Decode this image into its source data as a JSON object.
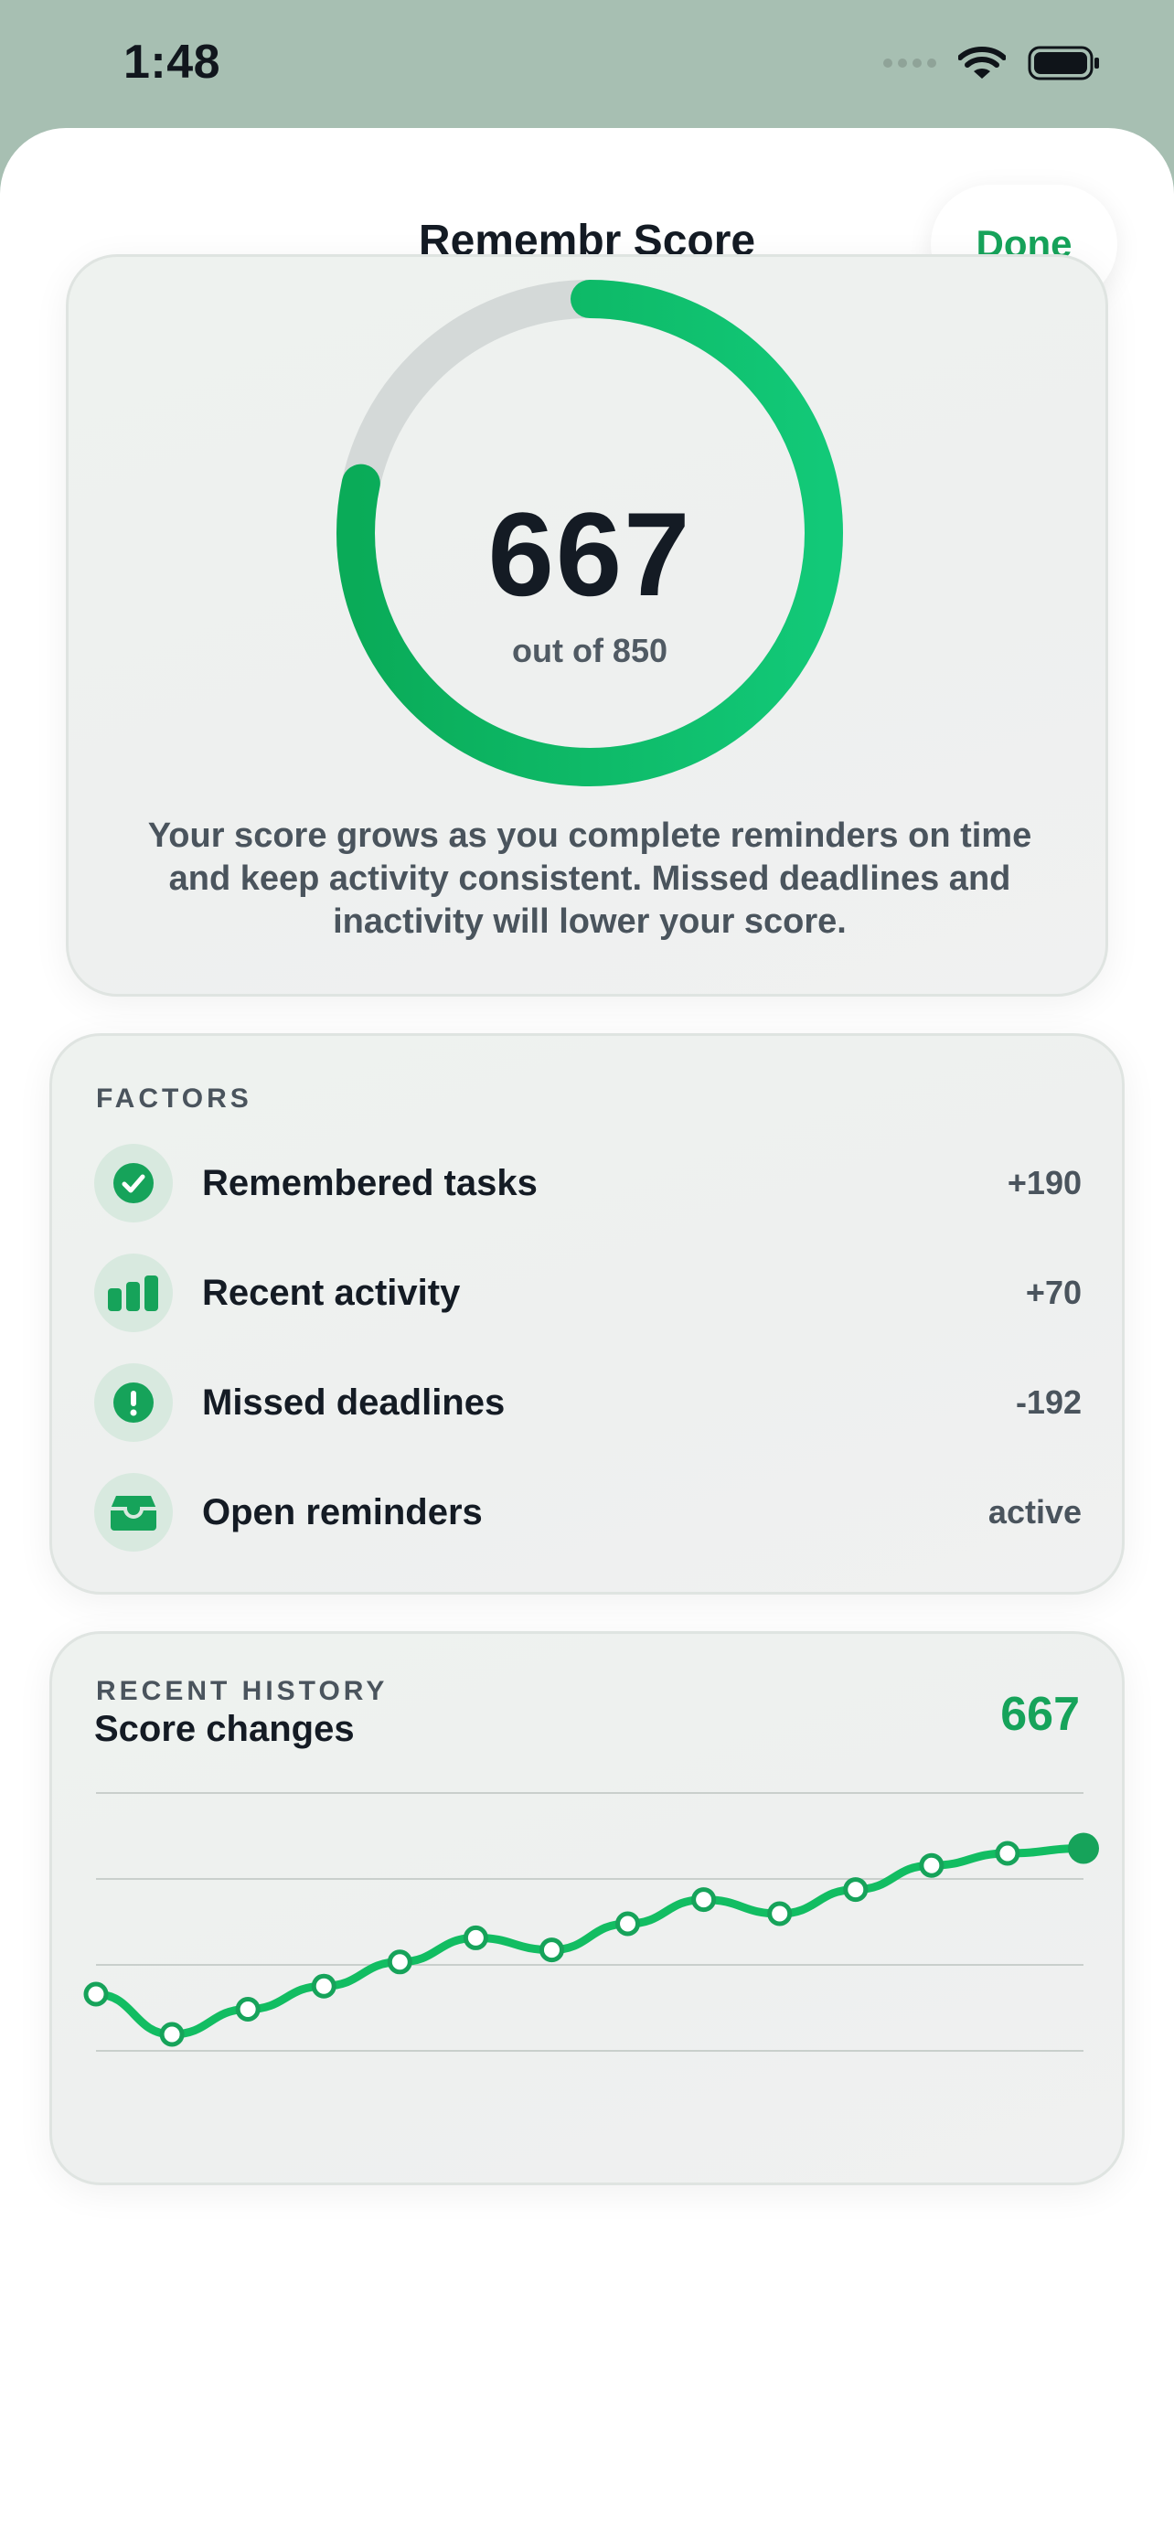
{
  "status_bar": {
    "time": "1:48",
    "icons": [
      "signal-dots-icon",
      "wifi-icon",
      "battery-icon"
    ]
  },
  "header": {
    "title": "Remembr Score",
    "done_label": "Done"
  },
  "score": {
    "value": "667",
    "out_of": "out of 850",
    "max": 850,
    "gauge_fraction": 0.784,
    "description": "Your score grows as you complete reminders on time and keep activity consistent. Missed deadlines and inactivity will lower your score."
  },
  "factors": {
    "section_label": "FACTORS",
    "items": [
      {
        "label": "Remembered tasks",
        "value": "+190",
        "icon": "checkmark-circle-icon"
      },
      {
        "label": "Recent activity",
        "value": "+70",
        "icon": "bar-chart-icon"
      },
      {
        "label": "Missed deadlines",
        "value": "-192",
        "icon": "exclamation-circle-icon"
      },
      {
        "label": "Open reminders",
        "value": "active",
        "icon": "inbox-tray-icon"
      }
    ]
  },
  "history": {
    "section_label": "RECENT HISTORY",
    "title": "Score changes",
    "current": "667"
  },
  "chart_data": {
    "type": "line",
    "title": "Score changes",
    "x": [
      1,
      2,
      3,
      4,
      5,
      6,
      7,
      8,
      9,
      10,
      11,
      12,
      13
    ],
    "series": [
      {
        "values": [
          560,
          520,
          545,
          568,
          592,
          616,
          604,
          630,
          654,
          640,
          664,
          688,
          700
        ]
      }
    ],
    "last_point": 705,
    "ylim": [
      500,
      760
    ],
    "grid": true,
    "colors": {
      "line": "#12bd62",
      "accent": "#16a35a"
    }
  }
}
